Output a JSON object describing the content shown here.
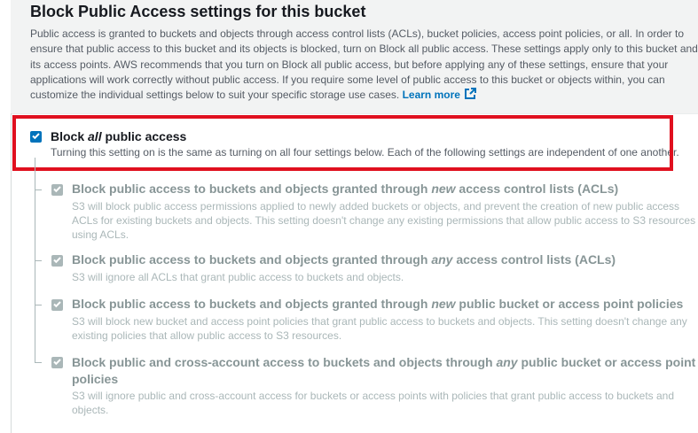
{
  "section": {
    "title": "Block Public Access settings for this bucket",
    "description": "Public access is granted to buckets and objects through access control lists (ACLs), bucket policies, access point policies, or all. In order to ensure that public access to this bucket and its objects is blocked, turn on Block all public access. These settings apply only to this bucket and its access points. AWS recommends that you turn on Block all public access, but before applying any of these settings, ensure that your applications will work correctly without public access. If you require some level of public access to this bucket or objects within, you can customize the individual settings below to suit your specific storage use cases.",
    "learn_more": "Learn more"
  },
  "block_all": {
    "title_pre": "Block ",
    "title_em": "all",
    "title_post": " public access",
    "description": "Turning this setting on is the same as turning on all four settings below. Each of the following settings are independent of one another.",
    "checked": true
  },
  "options": [
    {
      "title_pre": "Block public access to buckets and objects granted through ",
      "title_em": "new",
      "title_post": " access control lists (ACLs)",
      "description": "S3 will block public access permissions applied to newly added buckets or objects, and prevent the creation of new public access ACLs for existing buckets and objects. This setting doesn't change any existing permissions that allow public access to S3 resources using ACLs.",
      "checked": true
    },
    {
      "title_pre": "Block public access to buckets and objects granted through ",
      "title_em": "any",
      "title_post": " access control lists (ACLs)",
      "description": "S3 will ignore all ACLs that grant public access to buckets and objects.",
      "checked": true
    },
    {
      "title_pre": "Block public access to buckets and objects granted through ",
      "title_em": "new",
      "title_post": " public bucket or access point policies",
      "description": "S3 will block new bucket and access point policies that grant public access to buckets and objects. This setting doesn't change any existing policies that allow public access to S3 resources.",
      "checked": true
    },
    {
      "title_pre": "Block public and cross-account access to buckets and objects through ",
      "title_em": "any",
      "title_post": " public bucket or access point policies",
      "description": "S3 will ignore public and cross-account access for buckets or access points with policies that grant public access to buckets and objects.",
      "checked": true
    }
  ],
  "colors": {
    "accent": "#0073bb",
    "highlight": "#e0101f",
    "disabled": "#aab7b8"
  },
  "icons": [
    "external-link-icon",
    "checkmark-icon"
  ]
}
